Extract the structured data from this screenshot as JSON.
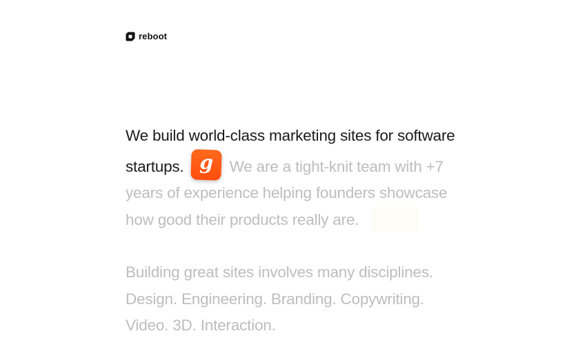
{
  "brand": {
    "name": "reboot",
    "logo_icon": "reboot-logo-icon"
  },
  "intro": {
    "headline": "We build world-class marketing sites for software startups.",
    "app_icon": {
      "letter": "g",
      "color": "#ff5a14",
      "icon": "g-app-icon"
    },
    "description": "We are a tight-knit team with +7 years of experience helping founders showcase how good their products really are."
  },
  "disciplines": {
    "text": "Building great sites involves many disciplines. Design. Engineering. Branding. Copywriting. Video. 3D. Interaction."
  },
  "colors": {
    "primary_text": "#1b1b1b",
    "muted_text": "#bdbdbd",
    "accent": "#ff5a14",
    "background": "#ffffff"
  }
}
